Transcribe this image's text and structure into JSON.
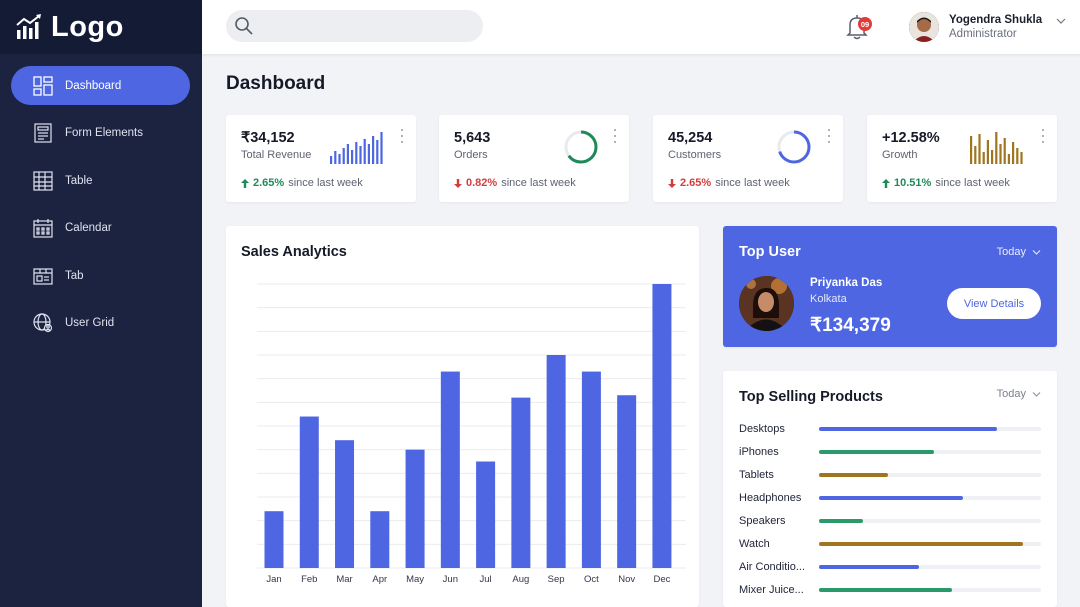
{
  "brand": {
    "logo_text": "Logo"
  },
  "sidebar": {
    "items": [
      {
        "label": "Dashboard",
        "icon": "dashboard-icon",
        "active": true
      },
      {
        "label": "Form Elements",
        "icon": "form-icon",
        "active": false
      },
      {
        "label": "Table",
        "icon": "table-icon",
        "active": false
      },
      {
        "label": "Calendar",
        "icon": "calendar-icon",
        "active": false
      },
      {
        "label": "Tab",
        "icon": "tab-icon",
        "active": false
      },
      {
        "label": "User Grid",
        "icon": "user-grid-icon",
        "active": false
      }
    ]
  },
  "topbar": {
    "search_placeholder": "",
    "notification_count": "09",
    "user": {
      "name": "Yogendra Shukla",
      "role": "Administrator"
    }
  },
  "page": {
    "title": "Dashboard"
  },
  "stats": [
    {
      "value": "₹34,152",
      "label": "Total Revenue",
      "change": "2.65%",
      "direction": "up",
      "suffix": "since last week",
      "visual": "bars",
      "color": "#4e66e2"
    },
    {
      "value": "5,643",
      "label": "Orders",
      "change": "0.82%",
      "direction": "down",
      "suffix": "since last week",
      "visual": "ring",
      "color": "#1f8a58",
      "ring_fraction": 0.65
    },
    {
      "value": "45,254",
      "label": "Customers",
      "change": "2.65%",
      "direction": "down",
      "suffix": "since last week",
      "visual": "ring",
      "color": "#4e66e2",
      "ring_fraction": 0.7
    },
    {
      "value": "+12.58%",
      "label": "Growth",
      "change": "10.51%",
      "direction": "up",
      "suffix": "since last week",
      "visual": "bars",
      "color": "#a0751f"
    }
  ],
  "sales": {
    "title": "Sales Analytics",
    "chart_data": {
      "type": "bar",
      "categories": [
        "Jan",
        "Feb",
        "Mar",
        "Apr",
        "May",
        "Jun",
        "Jul",
        "Aug",
        "Sep",
        "Oct",
        "Nov",
        "Dec"
      ],
      "values": [
        24,
        64,
        54,
        24,
        50,
        83,
        45,
        72,
        90,
        83,
        73,
        120
      ],
      "ylim": [
        0,
        120
      ],
      "grid": true,
      "color": "#4e66e2"
    }
  },
  "top_user": {
    "title": "Top User",
    "period": "Today",
    "name": "Priyanka Das",
    "city": "Kolkata",
    "amount": "₹134,379",
    "button": "View Details"
  },
  "top_products": {
    "title": "Top Selling Products",
    "period": "Today",
    "items": [
      {
        "name": "Desktops",
        "value": 0.8,
        "color": "#4e66e2"
      },
      {
        "name": "iPhones",
        "value": 0.52,
        "color": "#2a9a6b"
      },
      {
        "name": "Tablets",
        "value": 0.31,
        "color": "#a0751f"
      },
      {
        "name": "Headphones",
        "value": 0.65,
        "color": "#4e66e2"
      },
      {
        "name": "Speakers",
        "value": 0.2,
        "color": "#2a9a6b"
      },
      {
        "name": "Watch",
        "value": 0.92,
        "color": "#a0751f"
      },
      {
        "name": "Air Conditio...",
        "value": 0.45,
        "color": "#4e66e2"
      },
      {
        "name": "Mixer Juice...",
        "value": 0.6,
        "color": "#2a9a6b"
      }
    ]
  }
}
